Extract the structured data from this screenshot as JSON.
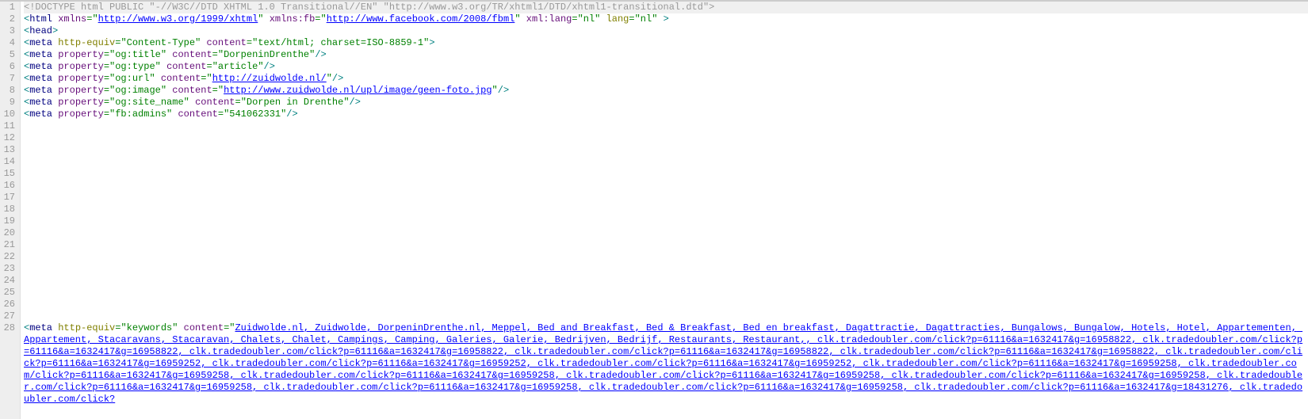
{
  "line_numbers": [
    "1",
    "2",
    "3",
    "4",
    "5",
    "6",
    "7",
    "8",
    "9",
    "10",
    "11",
    "12",
    "13",
    "14",
    "15",
    "16",
    "17",
    "18",
    "19",
    "20",
    "21",
    "22",
    "23",
    "24",
    "25",
    "26",
    "27",
    "28"
  ],
  "lines": {
    "l1": {
      "doctype": "<!DOCTYPE html PUBLIC \"-//W3C//DTD XHTML 1.0 Transitional//EN\" \"http://www.w3.org/TR/xhtml1/DTD/xhtml1-transitional.dtd\">"
    },
    "l2": {
      "open": "<",
      "tag": "html",
      "sp1": " ",
      "a1": "xmlns",
      "eq": "=",
      "q": "\"",
      "v1": "http://www.w3.org/1999/xhtml",
      "sp2": " ",
      "a2": "xmlns:fb",
      "v2": "http://www.facebook.com/2008/fbml",
      "sp3": " ",
      "a3": "xml:lang",
      "v3": "nl",
      "sp4": " ",
      "a4": "lang",
      "v4": "nl",
      "sp5": " ",
      "close": ">"
    },
    "l3": {
      "open": "<",
      "tag": "head",
      "close": ">"
    },
    "l4": {
      "open": "<",
      "tag": "meta",
      "sp1": " ",
      "a1": "http-equiv",
      "eq": "=",
      "q": "\"",
      "v1": "Content-Type",
      "sp2": " ",
      "a2": "content",
      "v2": "text/html; charset=ISO-8859-1",
      "close": ">"
    },
    "l5": {
      "open": "<",
      "tag": "meta",
      "sp1": " ",
      "a1": "property",
      "eq": "=",
      "q": "\"",
      "v1": "og:title",
      "sp2": " ",
      "a2": "content",
      "v2": "DorpeninDrenthe",
      "close": "/>"
    },
    "l6": {
      "open": "<",
      "tag": "meta",
      "sp1": " ",
      "a1": "property",
      "eq": "=",
      "q": "\"",
      "v1": "og:type",
      "sp2": " ",
      "a2": "content",
      "v2": "article",
      "close": "/>"
    },
    "l7": {
      "open": "<",
      "tag": "meta",
      "sp1": " ",
      "a1": "property",
      "eq": "=",
      "q": "\"",
      "v1": "og:url",
      "sp2": " ",
      "a2": "content",
      "v2": "http://zuidwolde.nl/",
      "close": "/>"
    },
    "l8": {
      "open": "<",
      "tag": "meta",
      "sp1": " ",
      "a1": "property",
      "eq": "=",
      "q": "\"",
      "v1": "og:image",
      "sp2": " ",
      "a2": "content",
      "v2": "http://www.zuidwolde.nl/upl/image/geen-foto.jpg",
      "close": "/>"
    },
    "l9": {
      "open": "<",
      "tag": "meta",
      "sp1": " ",
      "a1": "property",
      "eq": "=",
      "q": "\"",
      "v1": "og:site_name",
      "sp2": " ",
      "a2": "content",
      "v2": "Dorpen in Drenthe",
      "close": "/>"
    },
    "l10": {
      "open": "<",
      "tag": "meta",
      "sp1": " ",
      "a1": "property",
      "eq": "=",
      "q": "\"",
      "v1": "fb:admins",
      "sp2": " ",
      "a2": "content",
      "v2": "541062331",
      "close": "/>"
    },
    "l28": {
      "open": "<",
      "tag": "meta",
      "sp1": " ",
      "a1": "http-equiv",
      "eq": "=",
      "q": "\"",
      "v1": "keywords",
      "sp2": " ",
      "a2": "content",
      "v2": "Zuidwolde.nl, Zuidwolde, DorpeninDrenthe.nl, Meppel, Bed and Breakfast, Bed & Breakfast, Bed en breakfast, Dagattractie, Dagattracties, Bungalows, Bungalow, Hotels, Hotel, Appartementen, Appartement, Stacaravans, Stacaravan, Chalets, Chalet, Campings, Camping, Galeries, Galerie, Bedrijven, Bedrijf, Restaurants, Restaurant,, clk.tradedoubler.com/click?p=61116&a=1632417&g=16958822, clk.tradedoubler.com/click?p=61116&a=1632417&g=16958822, clk.tradedoubler.com/click?p=61116&a=1632417&g=16958822, clk.tradedoubler.com/click?p=61116&a=1632417&g=16958822, clk.tradedoubler.com/click?p=61116&a=1632417&g=16958822, clk.tradedoubler.com/click?p=61116&a=1632417&g=16959252, clk.tradedoubler.com/click?p=61116&a=1632417&g=16959252, clk.tradedoubler.com/click?p=61116&a=1632417&g=16959252, clk.tradedoubler.com/click?p=61116&a=1632417&g=16959258, clk.tradedoubler.com/click?p=61116&a=1632417&g=16959258, clk.tradedoubler.com/click?p=61116&a=1632417&g=16959258, clk.tradedoubler.com/click?p=61116&a=1632417&g=16959258, clk.tradedoubler.com/click?p=61116&a=1632417&g=16959258, clk.tradedoubler.com/click?p=61116&a=1632417&g=16959258, clk.tradedoubler.com/click?p=61116&a=1632417&g=16959258, clk.tradedoubler.com/click?p=61116&a=1632417&g=16959258, clk.tradedoubler.com/click?p=61116&a=1632417&g=18431276, clk.tradedoubler.com/click?"
    }
  }
}
